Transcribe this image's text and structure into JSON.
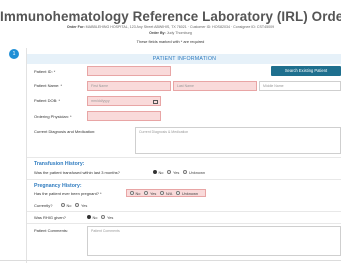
{
  "header": {
    "title": "Immunohematology Reference Laboratory (IRL) Order",
    "order_for_label": "Order For:",
    "order_for_value": "MABBLEHING HOSPITAL, 123 Any Street ABWIHIS, TX 76021 · Customer ID: HOS82034 · Consignee ID: CST45009",
    "order_by_label": "Order By:",
    "order_by_value": "Judy Thornburg",
    "required_note": "These fields marked with * are required"
  },
  "step_number": "1",
  "patient_section": {
    "title": "PATIENT INFORMATION",
    "search_button": "Search Existing Patient",
    "patient_id_label": "Patient ID: *",
    "patient_name_label": "Patient Name: *",
    "first_name_placeholder": "First Name",
    "last_name_placeholder": "Last Name",
    "middle_name_placeholder": "Middle Name",
    "dob_label": "Patient DOB: *",
    "dob_placeholder": "mm/dd/yyyy",
    "physician_label": "Ordering Physician: *",
    "diagnosis_label": "Current Diagnosis and Medication:",
    "diagnosis_placeholder": "Current Diagnosis & Medication"
  },
  "transfusion": {
    "heading": "Transfusion History:",
    "question": "Was the patient transfused within last 3 months?",
    "options": [
      "No",
      "Yes",
      "Unknown"
    ],
    "selected": "No"
  },
  "pregnancy": {
    "heading": "Pregnancy History:",
    "question": "Has the patient ever been pregnant? *",
    "options": [
      "No",
      "Yes",
      "N/A",
      "Unknown"
    ],
    "currently_label": "Currently?",
    "currently_options": [
      "No",
      "Yes"
    ],
    "rhig_label": "Was RHIG given?",
    "rhig_options": [
      "No",
      "Yes"
    ],
    "rhig_selected": "No"
  },
  "comments": {
    "label": "Patient Comments:",
    "placeholder": "Patient Comments"
  }
}
